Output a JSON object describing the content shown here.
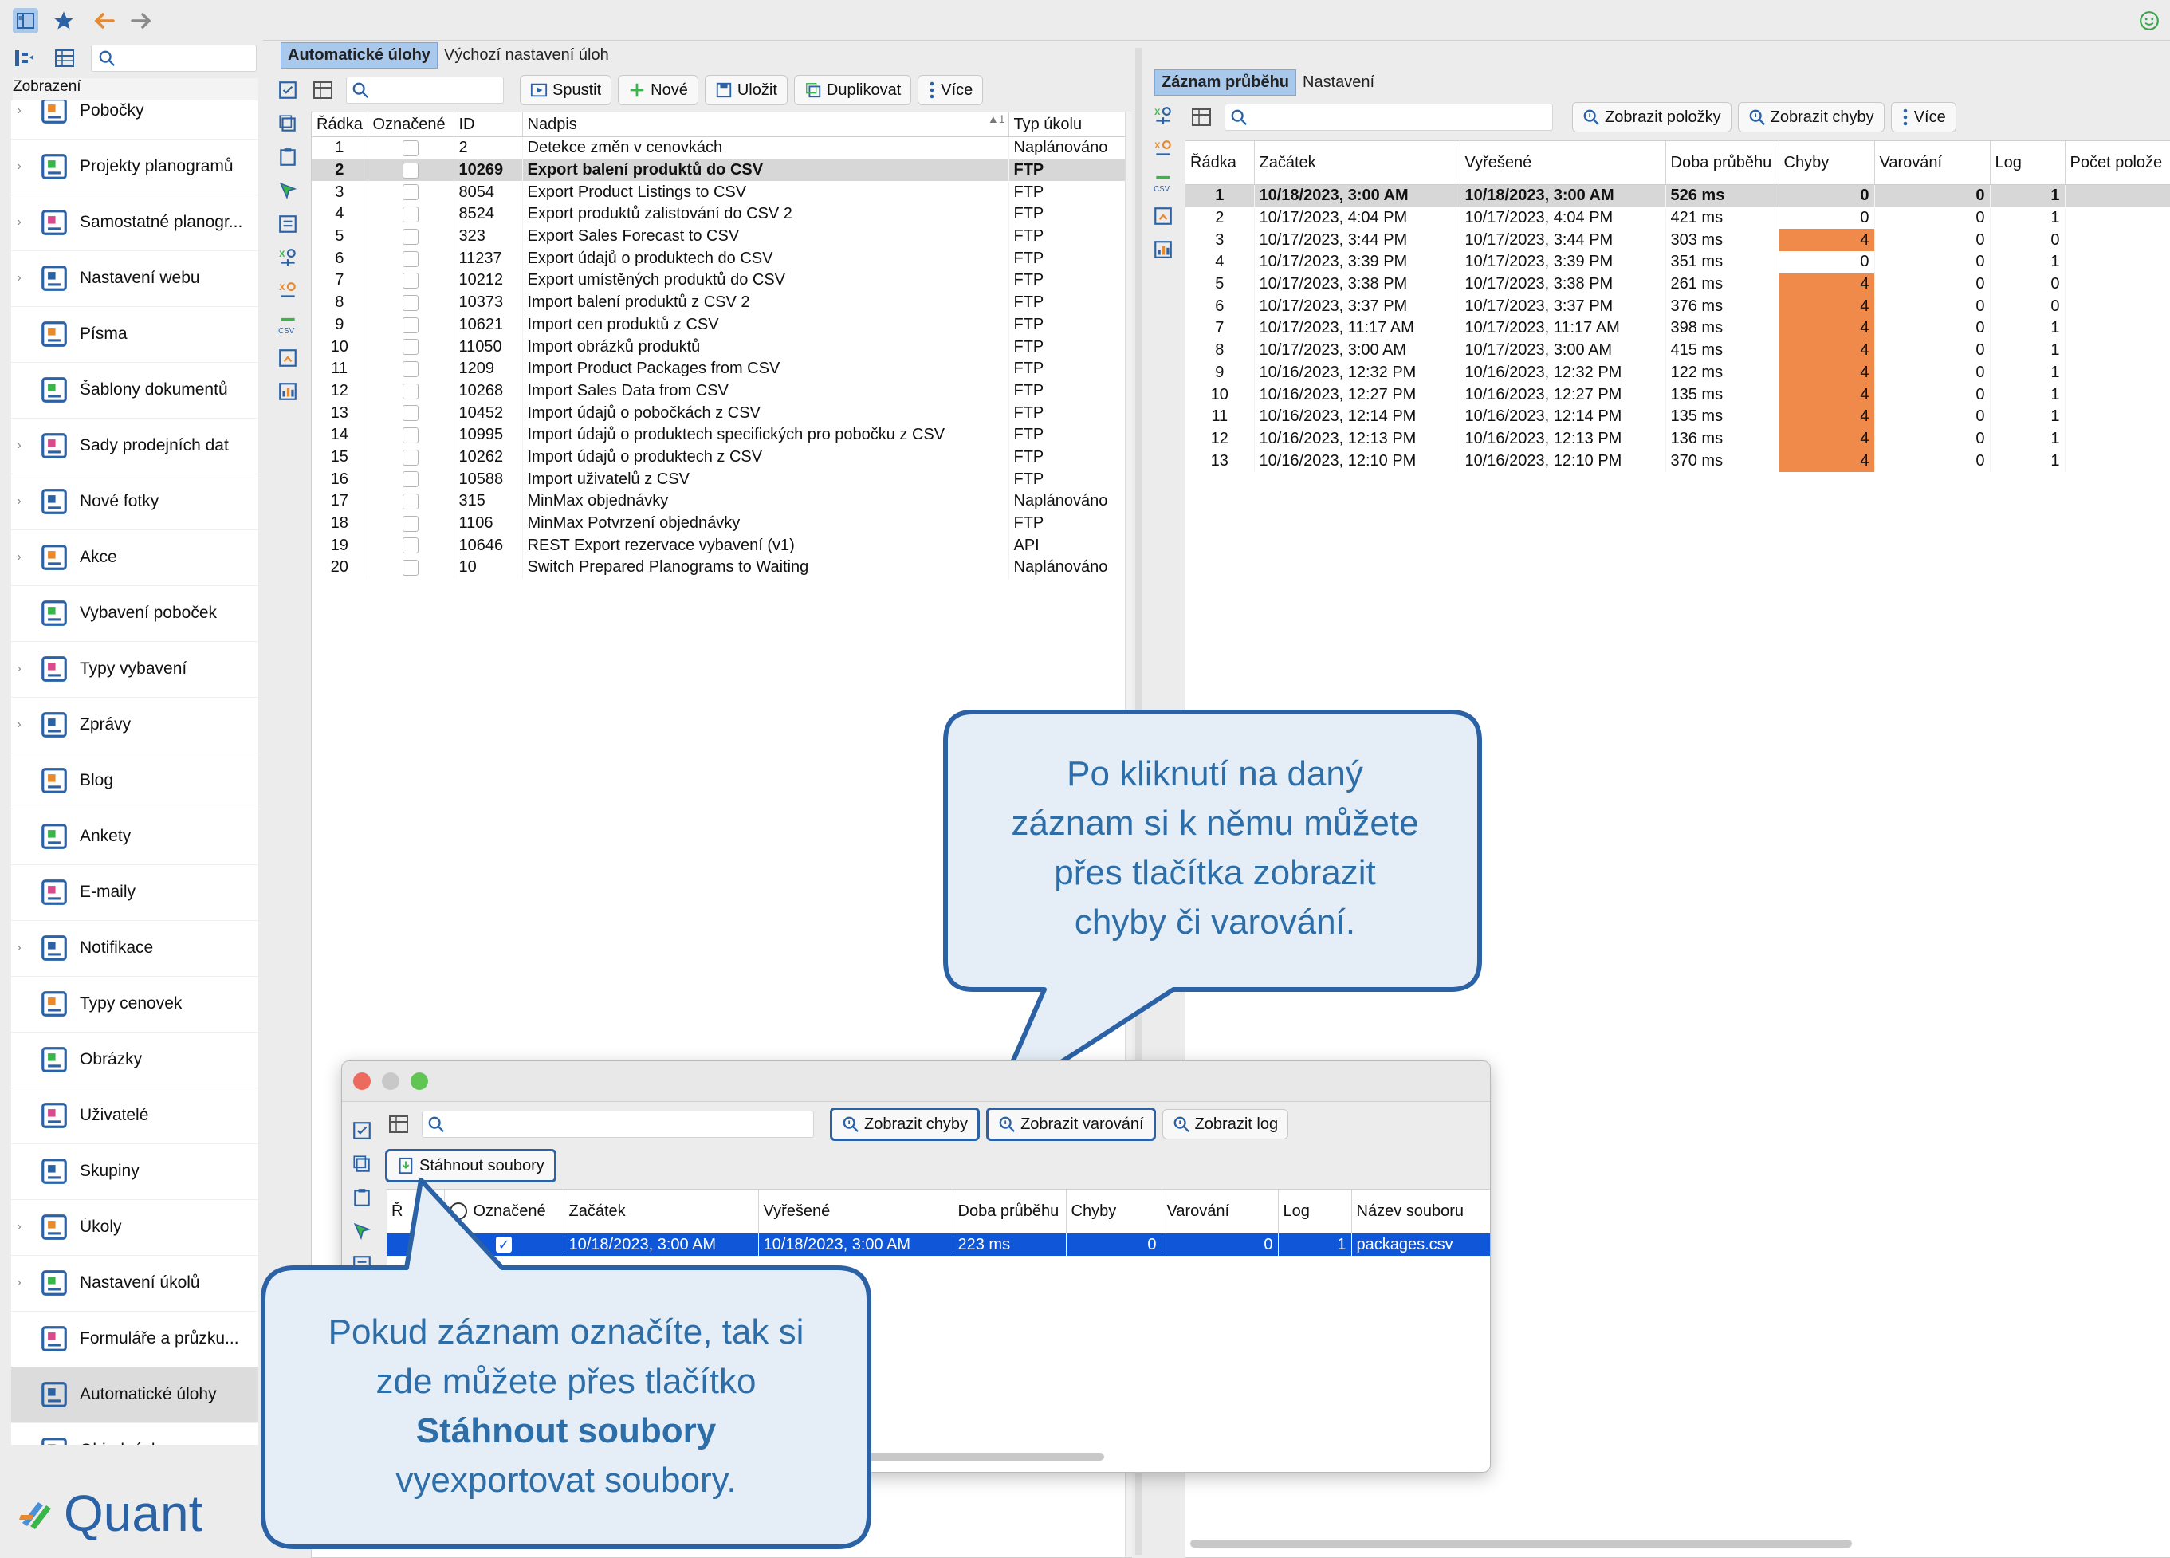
{
  "topbar": {
    "icons": [
      "sidebar-toggle-icon",
      "star-icon",
      "back-arrow-icon",
      "forward-arrow-icon",
      "smiley-icon"
    ]
  },
  "nav": {
    "title": "Zobrazení",
    "items": [
      {
        "label": "Pobočky",
        "icon": "stores-icon",
        "arrow": true
      },
      {
        "label": "Projekty planogramů",
        "icon": "planogram-projects-icon",
        "arrow": true
      },
      {
        "label": "Samostatné planogr...",
        "icon": "planograms-icon",
        "arrow": true
      },
      {
        "label": "Nastavení webu",
        "icon": "web-settings-icon",
        "arrow": true
      },
      {
        "label": "Písma",
        "icon": "fonts-icon",
        "arrow": false
      },
      {
        "label": "Šablony dokumentů",
        "icon": "document-templates-icon",
        "arrow": false
      },
      {
        "label": "Sady prodejních dat",
        "icon": "sales-data-icon",
        "arrow": true
      },
      {
        "label": "Nové fotky",
        "icon": "camera-icon",
        "arrow": true
      },
      {
        "label": "Akce",
        "icon": "clock-icon",
        "arrow": true
      },
      {
        "label": "Vybavení poboček",
        "icon": "store-equipment-icon",
        "arrow": false
      },
      {
        "label": "Typy vybavení",
        "icon": "equipment-types-icon",
        "arrow": true
      },
      {
        "label": "Zprávy",
        "icon": "messages-icon",
        "arrow": true
      },
      {
        "label": "Blog",
        "icon": "blog-icon",
        "arrow": false
      },
      {
        "label": "Ankety",
        "icon": "survey-icon",
        "arrow": false
      },
      {
        "label": "E-maily",
        "icon": "email-icon",
        "arrow": false
      },
      {
        "label": "Notifikace",
        "icon": "bell-icon",
        "arrow": true
      },
      {
        "label": "Typy cenovek",
        "icon": "price-tag-icon",
        "arrow": false
      },
      {
        "label": "Obrázky",
        "icon": "image-icon",
        "arrow": false
      },
      {
        "label": "Uživatelé",
        "icon": "user-icon",
        "arrow": false
      },
      {
        "label": "Skupiny",
        "icon": "group-icon",
        "arrow": false
      },
      {
        "label": "Úkoly",
        "icon": "task-check-icon",
        "arrow": true
      },
      {
        "label": "Nastavení úkolů",
        "icon": "task-settings-icon",
        "arrow": true
      },
      {
        "label": "Formuláře a průzku...",
        "icon": "forms-icon",
        "arrow": false
      },
      {
        "label": "Automatické úlohy",
        "icon": "automatic-tasks-icon",
        "arrow": false,
        "active": true
      },
      {
        "label": "Objednávky",
        "icon": "orders-icon",
        "arrow": true
      }
    ],
    "logo_text": "Quant"
  },
  "left_panel": {
    "tabs": [
      "Automatické úlohy",
      "Výchozí nastavení úloh"
    ],
    "toolbar": {
      "run": "Spustit",
      "new": "Nové",
      "save": "Uložit",
      "duplicate": "Duplikovat",
      "more": "Více"
    },
    "columns": [
      "Řádka",
      "Označené",
      "ID",
      "Nadpis",
      "Typ úkolu"
    ],
    "sort_indicator": "1",
    "rows": [
      {
        "row": "1",
        "id": "2",
        "title": "Detekce změn v cenovkách",
        "type": "Naplánováno"
      },
      {
        "row": "2",
        "id": "10269",
        "title": "Export balení produktů do CSV",
        "type": "FTP",
        "selected": true
      },
      {
        "row": "3",
        "id": "8054",
        "title": "Export Product Listings to CSV",
        "type": "FTP"
      },
      {
        "row": "4",
        "id": "8524",
        "title": "Export produktů zalistování do CSV 2",
        "type": "FTP"
      },
      {
        "row": "5",
        "id": "323",
        "title": "Export Sales Forecast to CSV",
        "type": "FTP"
      },
      {
        "row": "6",
        "id": "11237",
        "title": "Export údajů o produktech do CSV",
        "type": "FTP"
      },
      {
        "row": "7",
        "id": "10212",
        "title": "Export umístěných produktů do CSV",
        "type": "FTP"
      },
      {
        "row": "8",
        "id": "10373",
        "title": "Import balení produktů z CSV 2",
        "type": "FTP"
      },
      {
        "row": "9",
        "id": "10621",
        "title": "Import cen produktů z CSV",
        "type": "FTP"
      },
      {
        "row": "10",
        "id": "11050",
        "title": "Import obrázků produktů",
        "type": "FTP"
      },
      {
        "row": "11",
        "id": "1209",
        "title": "Import Product Packages from CSV",
        "type": "FTP"
      },
      {
        "row": "12",
        "id": "10268",
        "title": "Import Sales Data from CSV",
        "type": "FTP"
      },
      {
        "row": "13",
        "id": "10452",
        "title": "Import údajů o pobočkách z CSV",
        "type": "FTP"
      },
      {
        "row": "14",
        "id": "10995",
        "title": "Import údajů o produktech specifických pro pobočku z CSV",
        "type": "FTP"
      },
      {
        "row": "15",
        "id": "10262",
        "title": "Import údajů o produktech z CSV",
        "type": "FTP"
      },
      {
        "row": "16",
        "id": "10588",
        "title": "Import uživatelů z CSV",
        "type": "FTP"
      },
      {
        "row": "17",
        "id": "315",
        "title": "MinMax objednávky",
        "type": "Naplánováno"
      },
      {
        "row": "18",
        "id": "1106",
        "title": "MinMax Potvrzení objednávky",
        "type": "FTP"
      },
      {
        "row": "19",
        "id": "10646",
        "title": "REST Export rezervace vybavení (v1)",
        "type": "API"
      },
      {
        "row": "20",
        "id": "10",
        "title": "Switch Prepared Planograms to Waiting",
        "type": "Naplánováno"
      }
    ]
  },
  "right_panel": {
    "tabs": [
      "Záznam průběhu",
      "Nastavení"
    ],
    "toolbar": {
      "show_items": "Zobrazit položky",
      "show_errors": "Zobrazit chyby",
      "more": "Více"
    },
    "columns": [
      "Řádka",
      "Začátek",
      "Vyřešené",
      "Doba průběhu",
      "Chyby",
      "Varování",
      "Log",
      "Počet polože"
    ],
    "error_color": "#f08a4b",
    "rows": [
      {
        "row": "1",
        "start": "10/18/2023, 3:00 AM",
        "end": "10/18/2023, 3:00 AM",
        "duration": "526 ms",
        "errors": "0",
        "warnings": "0",
        "log": "1",
        "selected": true
      },
      {
        "row": "2",
        "start": "10/17/2023, 4:04 PM",
        "end": "10/17/2023, 4:04 PM",
        "duration": "421 ms",
        "errors": "0",
        "warnings": "0",
        "log": "1"
      },
      {
        "row": "3",
        "start": "10/17/2023, 3:44 PM",
        "end": "10/17/2023, 3:44 PM",
        "duration": "303 ms",
        "errors": "4",
        "warnings": "0",
        "log": "0"
      },
      {
        "row": "4",
        "start": "10/17/2023, 3:39 PM",
        "end": "10/17/2023, 3:39 PM",
        "duration": "351 ms",
        "errors": "0",
        "warnings": "0",
        "log": "1"
      },
      {
        "row": "5",
        "start": "10/17/2023, 3:38 PM",
        "end": "10/17/2023, 3:38 PM",
        "duration": "261 ms",
        "errors": "4",
        "warnings": "0",
        "log": "0"
      },
      {
        "row": "6",
        "start": "10/17/2023, 3:37 PM",
        "end": "10/17/2023, 3:37 PM",
        "duration": "376 ms",
        "errors": "4",
        "warnings": "0",
        "log": "0"
      },
      {
        "row": "7",
        "start": "10/17/2023, 11:17 AM",
        "end": "10/17/2023, 11:17 AM",
        "duration": "398 ms",
        "errors": "4",
        "warnings": "0",
        "log": "1"
      },
      {
        "row": "8",
        "start": "10/17/2023, 3:00 AM",
        "end": "10/17/2023, 3:00 AM",
        "duration": "415 ms",
        "errors": "4",
        "warnings": "0",
        "log": "1"
      },
      {
        "row": "9",
        "start": "10/16/2023, 12:32 PM",
        "end": "10/16/2023, 12:32 PM",
        "duration": "122 ms",
        "errors": "4",
        "warnings": "0",
        "log": "1"
      },
      {
        "row": "10",
        "start": "10/16/2023, 12:27 PM",
        "end": "10/16/2023, 12:27 PM",
        "duration": "135 ms",
        "errors": "4",
        "warnings": "0",
        "log": "1"
      },
      {
        "row": "11",
        "start": "10/16/2023, 12:14 PM",
        "end": "10/16/2023, 12:14 PM",
        "duration": "135 ms",
        "errors": "4",
        "warnings": "0",
        "log": "1"
      },
      {
        "row": "12",
        "start": "10/16/2023, 12:13 PM",
        "end": "10/16/2023, 12:13 PM",
        "duration": "136 ms",
        "errors": "4",
        "warnings": "0",
        "log": "1"
      },
      {
        "row": "13",
        "start": "10/16/2023, 12:10 PM",
        "end": "10/16/2023, 12:10 PM",
        "duration": "370 ms",
        "errors": "4",
        "warnings": "0",
        "log": "1"
      }
    ]
  },
  "dialog": {
    "toolbar": {
      "show_errors": "Zobrazit chyby",
      "show_warnings": "Zobrazit varování",
      "show_log": "Zobrazit log",
      "download_files": "Stáhnout soubory"
    },
    "columns": [
      "Ř",
      "Označené",
      "Začátek",
      "Vyřešené",
      "Doba průběhu",
      "Chyby",
      "Varování",
      "Log",
      "Název souboru"
    ],
    "row": {
      "start": "10/18/2023, 3:00 AM",
      "end": "10/18/2023, 3:00 AM",
      "duration": "223 ms",
      "errors": "0",
      "warnings": "0",
      "log": "1",
      "filename": "packages.csv"
    },
    "selection_color": "#0f56d8"
  },
  "callouts": {
    "top": {
      "line1": "Po kliknutí na daný",
      "line2": "záznam si k němu můžete",
      "line3": "přes tlačítka zobrazit",
      "line4": "chyby či varování."
    },
    "bottom": {
      "line1": "Pokud záznam označíte, tak si",
      "line2": "zde můžete přes tlačítko",
      "line3_bold": "Stáhnout soubory",
      "line4": "vyexportovat soubory."
    },
    "border_color": "#2b62a5",
    "fill_color": "#e5eef6",
    "text_color": "#2d6ea8"
  }
}
